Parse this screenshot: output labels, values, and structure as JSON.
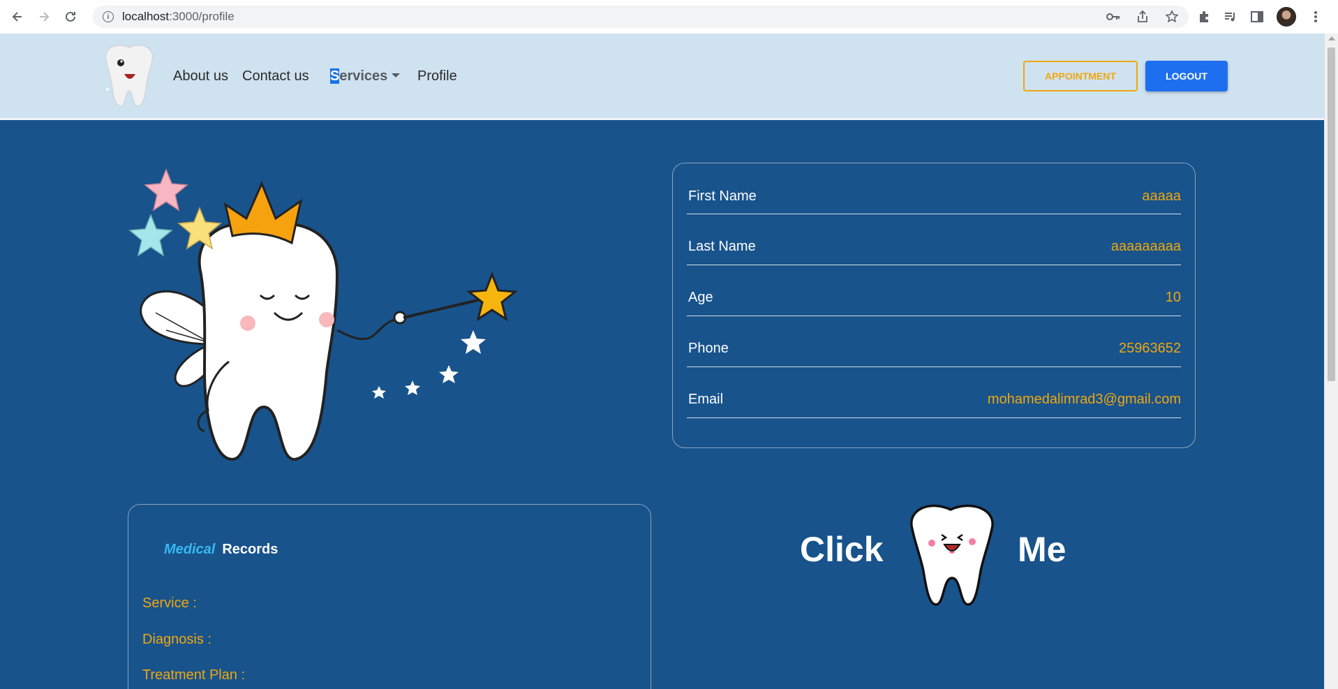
{
  "browser": {
    "url_host": "localhost",
    "url_path": ":3000/profile"
  },
  "nav": {
    "about": "About us",
    "contact": "Contact us",
    "services_first": "S",
    "services_rest": "ervices",
    "profile": "Profile",
    "appointment": "APPOINTMENT",
    "logout": "LOGOUT"
  },
  "profile": {
    "rows": [
      {
        "label": "First Name",
        "value": "aaaaa"
      },
      {
        "label": "Last Name",
        "value": "aaaaaaaaa"
      },
      {
        "label": "Age",
        "value": "10"
      },
      {
        "label": "Phone",
        "value": "25963652"
      },
      {
        "label": "Email",
        "value": "mohamedalimrad3@gmail.com"
      }
    ]
  },
  "records": {
    "title_accent": "Medical",
    "title_main": "Records",
    "service": "Service :",
    "diagnosis": "Diagnosis :",
    "treatment": "Treatment Plan :"
  },
  "click_me": {
    "left": "Click",
    "right": "Me"
  },
  "colors": {
    "page_bg": "#18538c",
    "nav_bg": "#cfe2ef",
    "accent_orange": "#f0a70e",
    "logout_blue": "#1e6ff0",
    "medical_cyan": "#36b9f0"
  }
}
